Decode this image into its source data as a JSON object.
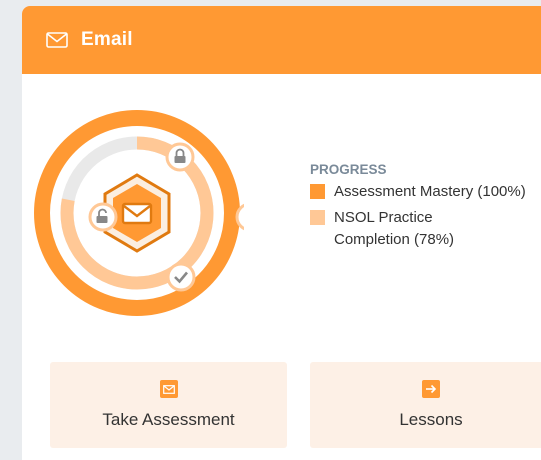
{
  "header": {
    "title": "Email",
    "icon": "envelope-icon",
    "color": "#ff9933"
  },
  "progress": {
    "heading": "PROGRESS",
    "items": [
      {
        "label": "Assessment Mastery (100%)",
        "value": 1.0,
        "color": "#ff9933"
      },
      {
        "label": "NSOL Practice Completion (78%)",
        "value": 0.78,
        "color": "#ffc896"
      }
    ],
    "icons": [
      "lock-icon",
      "unlock-icon",
      "lock-icon",
      "check-icon",
      "envelope-icon"
    ]
  },
  "actions": [
    {
      "label": "Take Assessment",
      "icon": "envelope-icon"
    },
    {
      "label": "Lessons",
      "icon": "arrow-right-icon"
    }
  ]
}
